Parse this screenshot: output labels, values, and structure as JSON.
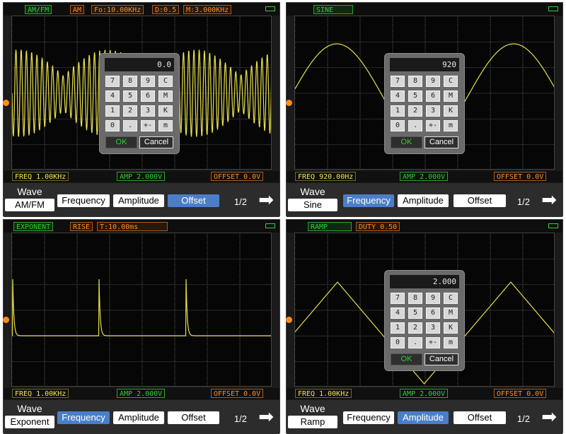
{
  "key_labels": [
    "7",
    "8",
    "9",
    "C",
    "4",
    "5",
    "6",
    "M",
    "1",
    "2",
    "3",
    "K",
    "0",
    ".",
    "+-",
    "m"
  ],
  "keypad_ok": "OK",
  "keypad_cancel": "Cancel",
  "wave_label": "Wave",
  "page_indicator": "1/2",
  "arrow_glyph": "➡",
  "panels": [
    {
      "header": [
        "AM/FM",
        "AM",
        "Fo:10.00KHz",
        "D:0.5",
        "M:3.000KHz"
      ],
      "info": {
        "freq": "FREQ 1.00KHz",
        "amp": "AMP 2.000V",
        "offset": "OFFSET 0.0V"
      },
      "wave_value": "AM/FM",
      "buttons": [
        "Frequency",
        "Amplitude",
        "Offset"
      ],
      "selected": "Offset",
      "keypad_display": "0.0"
    },
    {
      "header": [
        "SINE"
      ],
      "info": {
        "freq": "FREQ 920.00Hz",
        "amp": "AMP 2.000V",
        "offset": "OFFSET 0.0V"
      },
      "wave_value": "Sine",
      "buttons": [
        "Frequency",
        "Amplitude",
        "Offset"
      ],
      "selected": "Frequency",
      "keypad_display": "920"
    },
    {
      "header": [
        "EXPONENT",
        "RISE",
        "T:10.00ms"
      ],
      "info": {
        "freq": "FREQ 1.00KHz",
        "amp": "AMP 2.000V",
        "offset": "OFFSET 0.0V"
      },
      "wave_value": "Exponent",
      "buttons": [
        "Frequency",
        "Amplitude",
        "Offset"
      ],
      "selected": "Frequency",
      "keypad_display": null
    },
    {
      "header": [
        "RAMP",
        "DUTY 0.50"
      ],
      "info": {
        "freq": "FREQ 1.00KHz",
        "amp": "AMP 2.000V",
        "offset": "OFFSET 0.0V"
      },
      "wave_value": "Ramp",
      "buttons": [
        "Frequency",
        "Amplitude",
        "Offset"
      ],
      "selected": "Amplitude",
      "keypad_display": "2.000"
    }
  ],
  "colors": {
    "trace": "#e8e04a",
    "grid": "#2a2a2a",
    "grid_dots": "#4a4a4a",
    "selected_button": "#4a7fc8",
    "label_green": "#2fd02f",
    "label_orange": "#ff8c2a",
    "label_yellow": "#f0e44a"
  }
}
